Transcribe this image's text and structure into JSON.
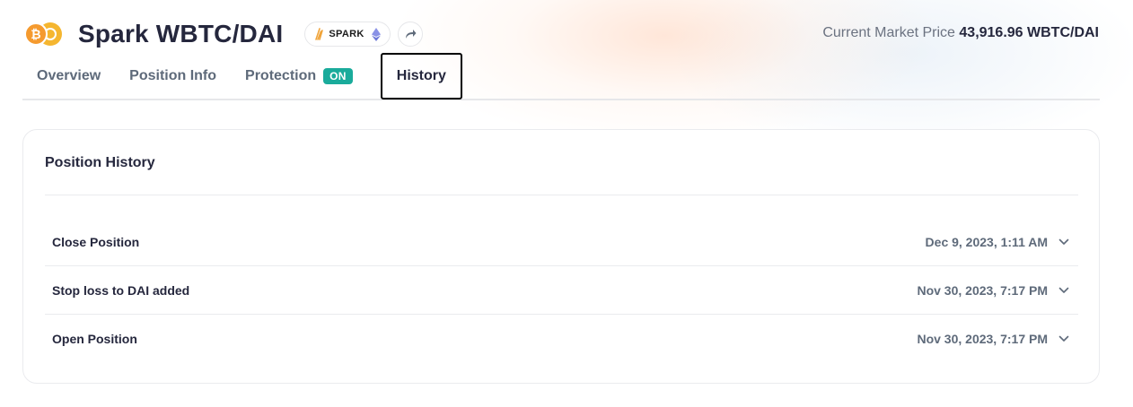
{
  "header": {
    "title": "Spark WBTC/DAI",
    "token_icons": [
      "btc-icon",
      "dai-icon"
    ],
    "protocol_label": "SPARK",
    "network_icon": "ethereum-icon",
    "share_icon": "share-arrow-icon"
  },
  "market_price": {
    "label": "Current Market Price",
    "value": "43,916.96 WBTC/DAI"
  },
  "tabs": [
    {
      "label": "Overview"
    },
    {
      "label": "Position Info"
    },
    {
      "label": "Protection",
      "badge": "ON"
    },
    {
      "label": "History",
      "active": true
    }
  ],
  "history": {
    "title": "Position History",
    "items": [
      {
        "label": "Close Position",
        "date": "Dec 9, 2023, 1:11 AM"
      },
      {
        "label": "Stop loss to DAI added",
        "date": "Nov 30, 2023, 7:17 PM"
      },
      {
        "label": "Open Position",
        "date": "Nov 30, 2023, 7:17 PM"
      }
    ]
  },
  "colors": {
    "accent_badge": "#1aab9b",
    "btc": "#f59a2e",
    "dai": "#f5b630",
    "text_primary": "#25273d",
    "text_secondary": "#5e6a7a"
  }
}
